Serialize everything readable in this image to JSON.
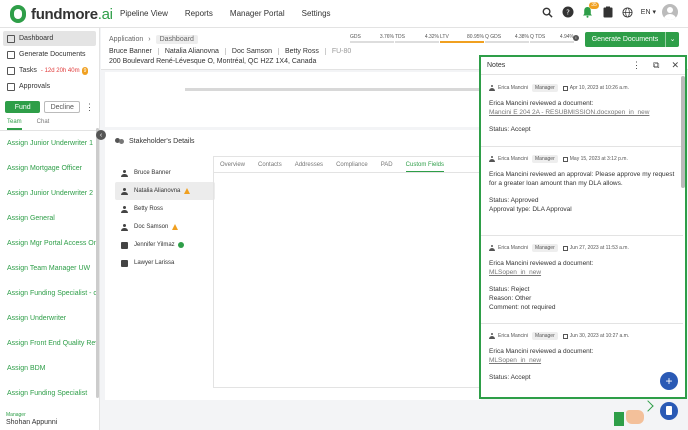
{
  "brand": {
    "name": "fundmore",
    "suffix": ".ai"
  },
  "nav": [
    "Pipeline View",
    "Reports",
    "Manager Portal",
    "Settings"
  ],
  "topbar": {
    "bell_count": "35",
    "language": "EN"
  },
  "sidebar": {
    "menu": [
      {
        "label": "Dashboard",
        "icon": "dashboard-icon"
      },
      {
        "label": "Generate Documents",
        "icon": "document-icon"
      },
      {
        "label": "Tasks",
        "icon": "tasks-icon",
        "overdue": "- 12d 20h 40m",
        "badge": "9"
      },
      {
        "label": "Approvals",
        "icon": "approvals-icon"
      }
    ],
    "fund_label": "Fund",
    "decline_label": "Decline",
    "tabs": [
      "Team",
      "Chat"
    ],
    "assign_items": [
      "Assign Junior Underwriter 1",
      "Assign Mortgage Officer",
      "Assign Junior Underwriter 2",
      "Assign General",
      "Assign Mgr Portal Access Only",
      "Assign Team Manager UW",
      "Assign Funding Specialist - clos",
      "Assign Underwriter",
      "Assign Front End Quality Review",
      "Assign BDM",
      "Assign Funding Specialist"
    ],
    "footer_role": "Manager",
    "footer_name": "Shohan Appunni"
  },
  "header": {
    "breadcrumb": [
      "Application",
      "Dashboard"
    ],
    "borrowers": [
      "Bruce Banner",
      "Natalia Alianovna",
      "Doc Samson",
      "Betty Ross",
      "FU-80"
    ],
    "address": "200 Boulevard René-Lévesque O, Montréal, QC H2Z 1X4, Canada",
    "metrics": [
      {
        "label": "GDS",
        "value": "3.76%"
      },
      {
        "label": "TDS",
        "value": "4.32%"
      },
      {
        "label": "LTV",
        "value": "80.95%"
      },
      {
        "label": "Q GDS",
        "value": "4.38%"
      },
      {
        "label": "Q TDS",
        "value": "4.94%"
      }
    ],
    "generate_label": "Generate Documents"
  },
  "stakeholders": {
    "title": "Stakeholder's Details",
    "people": [
      {
        "name": "Bruce Banner"
      },
      {
        "name": "Natalia Alianovna"
      },
      {
        "name": "Betty Ross"
      },
      {
        "name": "Doc Samson"
      },
      {
        "name": "Jennifer Yilmaz"
      },
      {
        "name": "Lawyer Larissa"
      }
    ],
    "tabs": [
      "Overview",
      "Contacts",
      "Addresses",
      "Compliance",
      "PAD",
      "Custom Fields"
    ]
  },
  "notes": {
    "title": "Notes",
    "items": [
      {
        "author": "Erica Mancini",
        "role": "Manager",
        "date": "Apr 10, 2023 at 10:26 a.m.",
        "text": "Erica Mancini reviewed a document:",
        "link": "Mancini E 204 2A - RESUBMISSION.docxopen_in_new",
        "lines": [
          "Status: Accept"
        ]
      },
      {
        "author": "Erica Mancini",
        "role": "Manager",
        "date": "May 15, 2023 at 3:12 p.m.",
        "text": "Erica Mancini reviewed an approval: Please approve my request for a greater loan amount than my DLA allows.",
        "link": "",
        "lines": [
          "Status: Approved",
          "Approval type: DLA Approval"
        ]
      },
      {
        "author": "Erica Mancini",
        "role": "Manager",
        "date": "Jun 27, 2023 at 11:53 a.m.",
        "text": "Erica  Mancini reviewed a document:",
        "link": "MLSopen_in_new",
        "lines": [
          "Status: Reject",
          "Reason: Other",
          "Comment: not required"
        ]
      },
      {
        "author": "Erica Mancini",
        "role": "Manager",
        "date": "Jun 30, 2023 at 10:27 a.m.",
        "text": "Erica  Mancini reviewed a document:",
        "link": "MLSopen_in_new",
        "lines": [
          "Status: Accept"
        ]
      }
    ]
  }
}
